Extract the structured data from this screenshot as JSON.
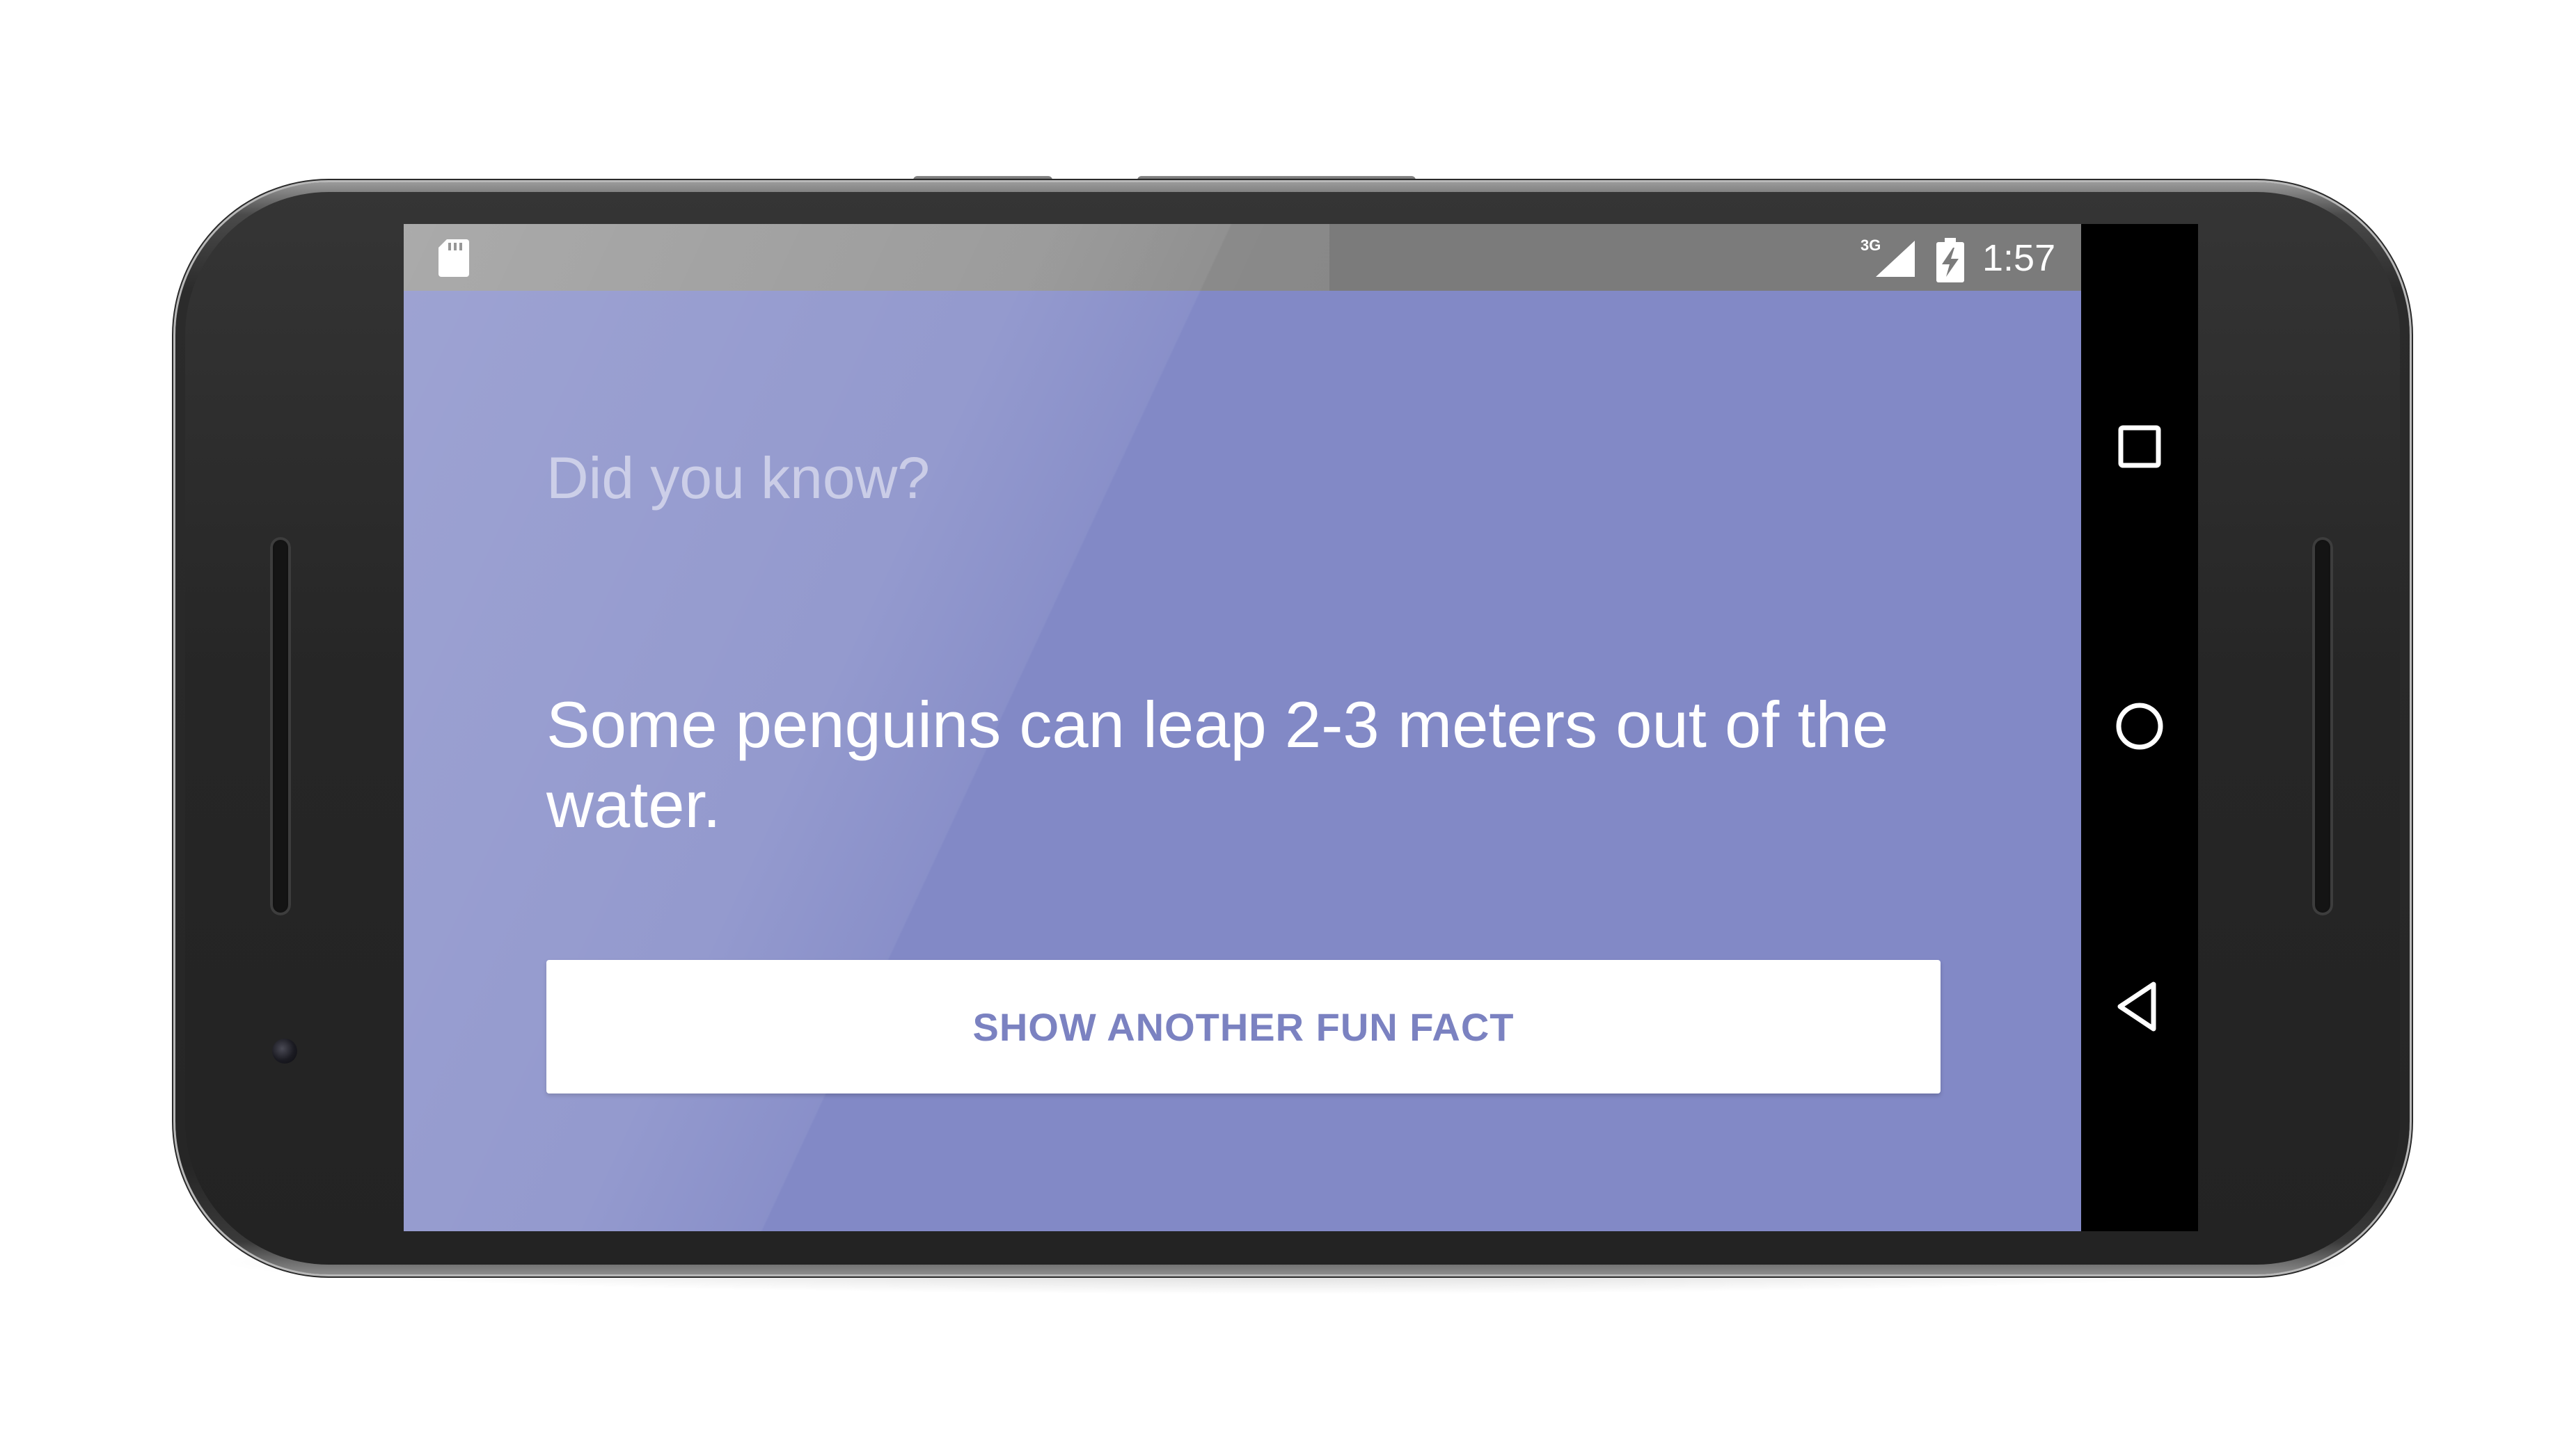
{
  "status_bar": {
    "left_icon": "sd-card-icon",
    "network_type": "3G",
    "signal_icon": "cell-signal-icon",
    "battery_icon": "battery-charging-icon",
    "time": "1:57"
  },
  "app": {
    "heading": "Did you know?",
    "fact": "Some penguins can leap 2-3 meters out of the water.",
    "button_label": "SHOW ANOTHER FUN FACT",
    "background_color": "#8289c6",
    "button_text_color": "#7b82c1"
  },
  "nav_bar": {
    "items": [
      {
        "icon": "recents-square-icon"
      },
      {
        "icon": "home-circle-icon"
      },
      {
        "icon": "back-triangle-icon"
      }
    ]
  }
}
